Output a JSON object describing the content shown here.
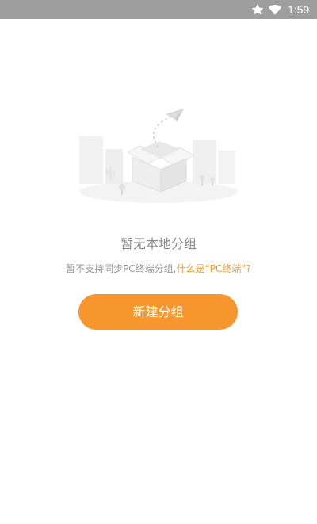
{
  "status_bar": {
    "time": "1:59",
    "icons": [
      "star-icon",
      "wifi-icon"
    ],
    "background": "#9e9e9e"
  },
  "empty_state": {
    "illustration": "empty-box-paper-plane-illustration",
    "title": "暂无本地分组",
    "subtitle_text": "暂不支持同步PC终端分组,",
    "subtitle_link": "什么是“PC终端”?"
  },
  "actions": {
    "new_group_label": "新建分组"
  },
  "colors": {
    "accent": "#f8962e",
    "link": "#f49b2f",
    "muted_text": "#8a8a8a"
  }
}
